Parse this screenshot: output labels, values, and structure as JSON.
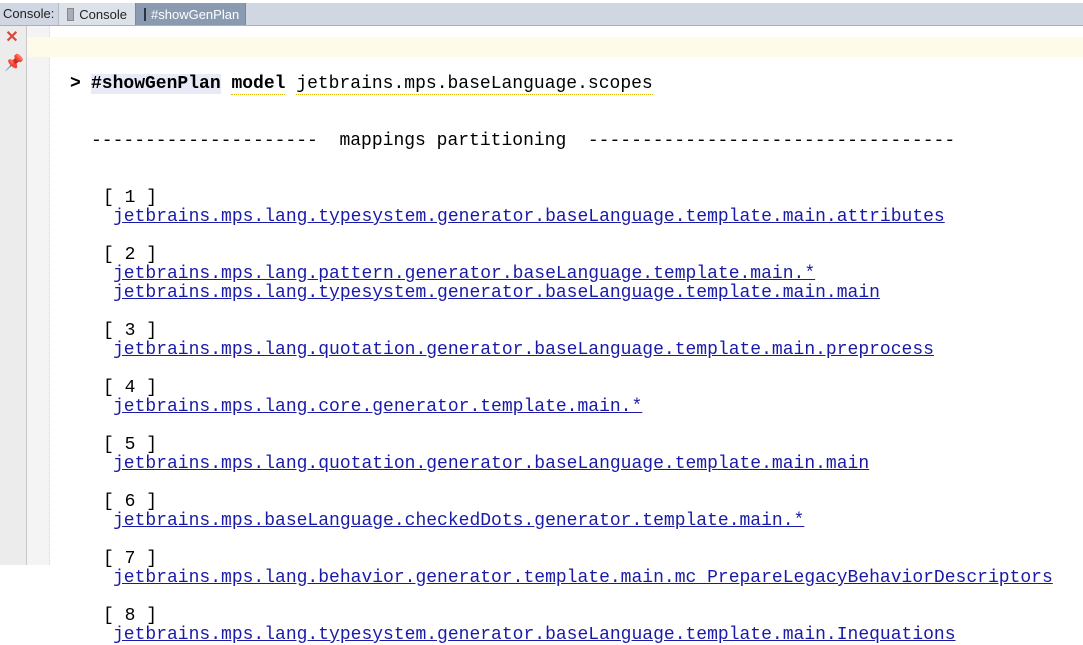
{
  "tabbar": {
    "label": "Console:",
    "tabs": [
      {
        "label": "Console",
        "active": false
      },
      {
        "label": "#showGenPlan",
        "active": true
      }
    ]
  },
  "toolbar": {
    "close_icon": "close-icon",
    "pin_icon": "pin-icon"
  },
  "console": {
    "prompt": ">",
    "command": {
      "name": "#showGenPlan",
      "keyword": "model",
      "argument": "jetbrains.mps.baseLanguage.scopes"
    },
    "separator": "---------------------  mappings partitioning  ----------------------------------",
    "groups": [
      {
        "index": "[ 1 ]",
        "links": [
          "jetbrains.mps.lang.typesystem.generator.baseLanguage.template.main.attributes"
        ]
      },
      {
        "index": "[ 2 ]",
        "links": [
          "jetbrains.mps.lang.pattern.generator.baseLanguage.template.main.*",
          "jetbrains.mps.lang.typesystem.generator.baseLanguage.template.main.main"
        ]
      },
      {
        "index": "[ 3 ]",
        "links": [
          "jetbrains.mps.lang.quotation.generator.baseLanguage.template.main.preprocess"
        ]
      },
      {
        "index": "[ 4 ]",
        "links": [
          "jetbrains.mps.lang.core.generator.template.main.*"
        ]
      },
      {
        "index": "[ 5 ]",
        "links": [
          "jetbrains.mps.lang.quotation.generator.baseLanguage.template.main.main"
        ]
      },
      {
        "index": "[ 6 ]",
        "links": [
          "jetbrains.mps.baseLanguage.checkedDots.generator.template.main.*"
        ]
      },
      {
        "index": "[ 7 ]",
        "links": [
          "jetbrains.mps.lang.behavior.generator.template.main.mc_PrepareLegacyBehaviorDescriptors"
        ]
      },
      {
        "index": "[ 8 ]",
        "links": [
          "jetbrains.mps.lang.typesystem.generator.baseLanguage.template.main.Inequations"
        ]
      }
    ]
  }
}
